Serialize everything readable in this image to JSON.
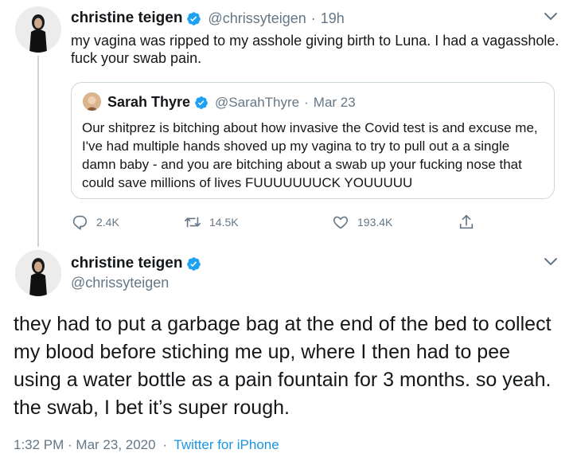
{
  "colors": {
    "text": "#14171a",
    "muted": "#657786",
    "link": "#1b95e0",
    "verified": "#1da1f2",
    "border": "#ccd6dd"
  },
  "tweet1": {
    "author_name": "christine teigen",
    "author_handle": "@chrissyteigen",
    "separator": "·",
    "time": "19h",
    "text": "my vagina was ripped to my asshole giving birth to Luna. I had a vagasshole. fuck your swab pain.",
    "avatar_icon": "profile-photo",
    "verified_icon": "verified-badge-icon",
    "menu_icon": "chevron-down-icon",
    "quote": {
      "author_name": "Sarah Thyre",
      "author_handle": "@SarahThyre",
      "separator": "·",
      "time": "Mar 23",
      "text": "Our shitprez is bitching about how invasive the Covid test is and excuse me, I've had multiple hands shoved up my vagina to try to pull out a a single damn baby - and you are bitching about a swab up your fucking nose that could save millions of lives FUUUUUUUCK YOUUUUU"
    },
    "actions": {
      "reply_count": "2.4K",
      "retweet_count": "14.5K",
      "like_count": "193.4K",
      "reply_icon": "reply-icon",
      "retweet_icon": "retweet-icon",
      "like_icon": "heart-icon",
      "share_icon": "share-icon"
    }
  },
  "tweet2": {
    "author_name": "christine teigen",
    "author_handle": "@chrissyteigen",
    "text": "they had to put a garbage bag at the end of the bed to collect my blood before stiching me up, where I then had to pee using a water bottle as a pain fountain for 3 months. so yeah. the swab, I bet it’s super rough.",
    "timestamp": "1:32 PM · Mar 23, 2020",
    "separator": "·",
    "source": "Twitter for iPhone"
  }
}
